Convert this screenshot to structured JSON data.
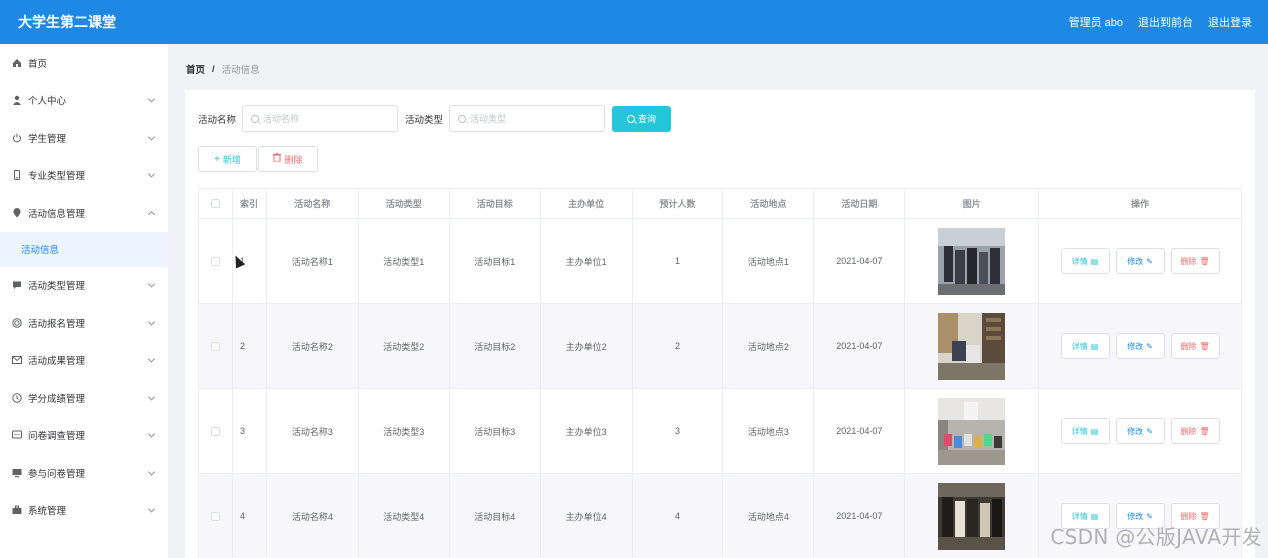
{
  "header": {
    "app_title": "大学生第二课堂",
    "user": "管理员 abo",
    "to_frontend": "退出到前台",
    "logout": "退出登录"
  },
  "sidebar": {
    "items": [
      {
        "label": "首页",
        "icon": "home-icon",
        "expandable": false
      },
      {
        "label": "个人中心",
        "icon": "user-icon",
        "expandable": true
      },
      {
        "label": "学生管理",
        "icon": "power-icon",
        "expandable": true
      },
      {
        "label": "专业类型管理",
        "icon": "phone-icon",
        "expandable": true
      },
      {
        "label": "活动信息管理",
        "icon": "location-icon",
        "expandable": true,
        "expanded": true
      },
      {
        "label": "活动类型管理",
        "icon": "chat-icon",
        "expandable": true
      },
      {
        "label": "活动报名管理",
        "icon": "coin-icon",
        "expandable": true
      },
      {
        "label": "活动成果管理",
        "icon": "mail-icon",
        "expandable": true
      },
      {
        "label": "学分成绩管理",
        "icon": "clock-icon",
        "expandable": true
      },
      {
        "label": "问卷调查管理",
        "icon": "message-icon",
        "expandable": true
      },
      {
        "label": "参与问卷管理",
        "icon": "monitor-icon",
        "expandable": true
      },
      {
        "label": "系统管理",
        "icon": "suitcase-icon",
        "expandable": true
      }
    ],
    "active_subitem": "活动信息"
  },
  "breadcrumb": {
    "home": "首页",
    "separator": "/",
    "current": "活动信息"
  },
  "search": {
    "name_label": "活动名称",
    "name_placeholder": "活动名称",
    "type_label": "活动类型",
    "type_placeholder": "活动类型",
    "query_label": "查询"
  },
  "actions": {
    "add_label": "新增",
    "delete_label": "删除"
  },
  "table": {
    "headers": [
      "索引",
      "活动名称",
      "活动类型",
      "活动目标",
      "主办单位",
      "预计人数",
      "活动地点",
      "活动日期",
      "图片",
      "操作"
    ],
    "rows": [
      {
        "index": "1",
        "name": "活动名称1",
        "type": "活动类型1",
        "goal": "活动目标1",
        "organizer": "主办单位1",
        "people": "1",
        "location": "活动地点1",
        "date": "2021-04-07"
      },
      {
        "index": "2",
        "name": "活动名称2",
        "type": "活动类型2",
        "goal": "活动目标2",
        "organizer": "主办单位2",
        "people": "2",
        "location": "活动地点2",
        "date": "2021-04-07"
      },
      {
        "index": "3",
        "name": "活动名称3",
        "type": "活动类型3",
        "goal": "活动目标3",
        "organizer": "主办单位3",
        "people": "3",
        "location": "活动地点3",
        "date": "2021-04-07"
      },
      {
        "index": "4",
        "name": "活动名称4",
        "type": "活动类型4",
        "goal": "活动目标4",
        "organizer": "主办单位4",
        "people": "4",
        "location": "活动地点4",
        "date": "2021-04-07"
      }
    ],
    "op_labels": {
      "detail": "详情",
      "edit": "修改",
      "delete": "删除"
    }
  },
  "watermark": "CSDN @公版JAVA开发",
  "colors": {
    "primary": "#1e88e5",
    "teal": "#26c6da",
    "danger": "#f56c6c"
  }
}
